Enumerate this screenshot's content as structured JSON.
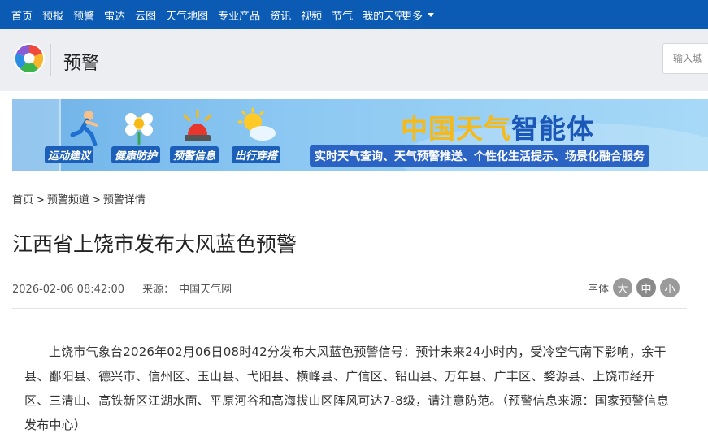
{
  "topnav": {
    "items": [
      "首页",
      "预报",
      "预警",
      "雷达",
      "云图",
      "天气地图",
      "专业产品",
      "资讯",
      "视频",
      "节气",
      "我的天空"
    ],
    "more": "更多"
  },
  "header": {
    "section_title": "预警",
    "search_placeholder": "输入城"
  },
  "banner": {
    "badges": [
      "运动建议",
      "健康防护",
      "预警信息",
      "出行穿搭"
    ],
    "title_part1": "中国天气",
    "title_part2": "智能体",
    "subtitle": "实时天气查询、天气预警推送、个性化生活提示、场景化融合服务"
  },
  "breadcrumb": {
    "items": [
      "首页",
      "预警频道",
      "预警详情"
    ],
    "separator": ">"
  },
  "article": {
    "title": "江西省上饶市发布大风蓝色预警",
    "datetime": "2026-02-06 08:42:00",
    "source_label": "来源：",
    "source": "中国天气网",
    "body": "上饶市气象台2026年02月06日08时42分发布大风蓝色预警信号：预计未来24小时内，受冷空气南下影响，余干县、鄱阳县、德兴市、信州区、玉山县、弋阳县、横峰县、广信区、铅山县、万年县、广丰区、婺源县、上饶市经开区、三清山、高铁新区江湖水面、平原河谷和高海拔山区阵风可达7-8级，请注意防范。（预警信息来源：国家预警信息发布中心）"
  },
  "fontsize": {
    "label": "字体",
    "large": "大",
    "medium": "中",
    "small": "小"
  },
  "colors": {
    "nav_blue": "#0b5bb5",
    "header_bg": "#eceef1",
    "banner_yellow": "#f7b916",
    "banner_blue": "#1a57b8"
  }
}
